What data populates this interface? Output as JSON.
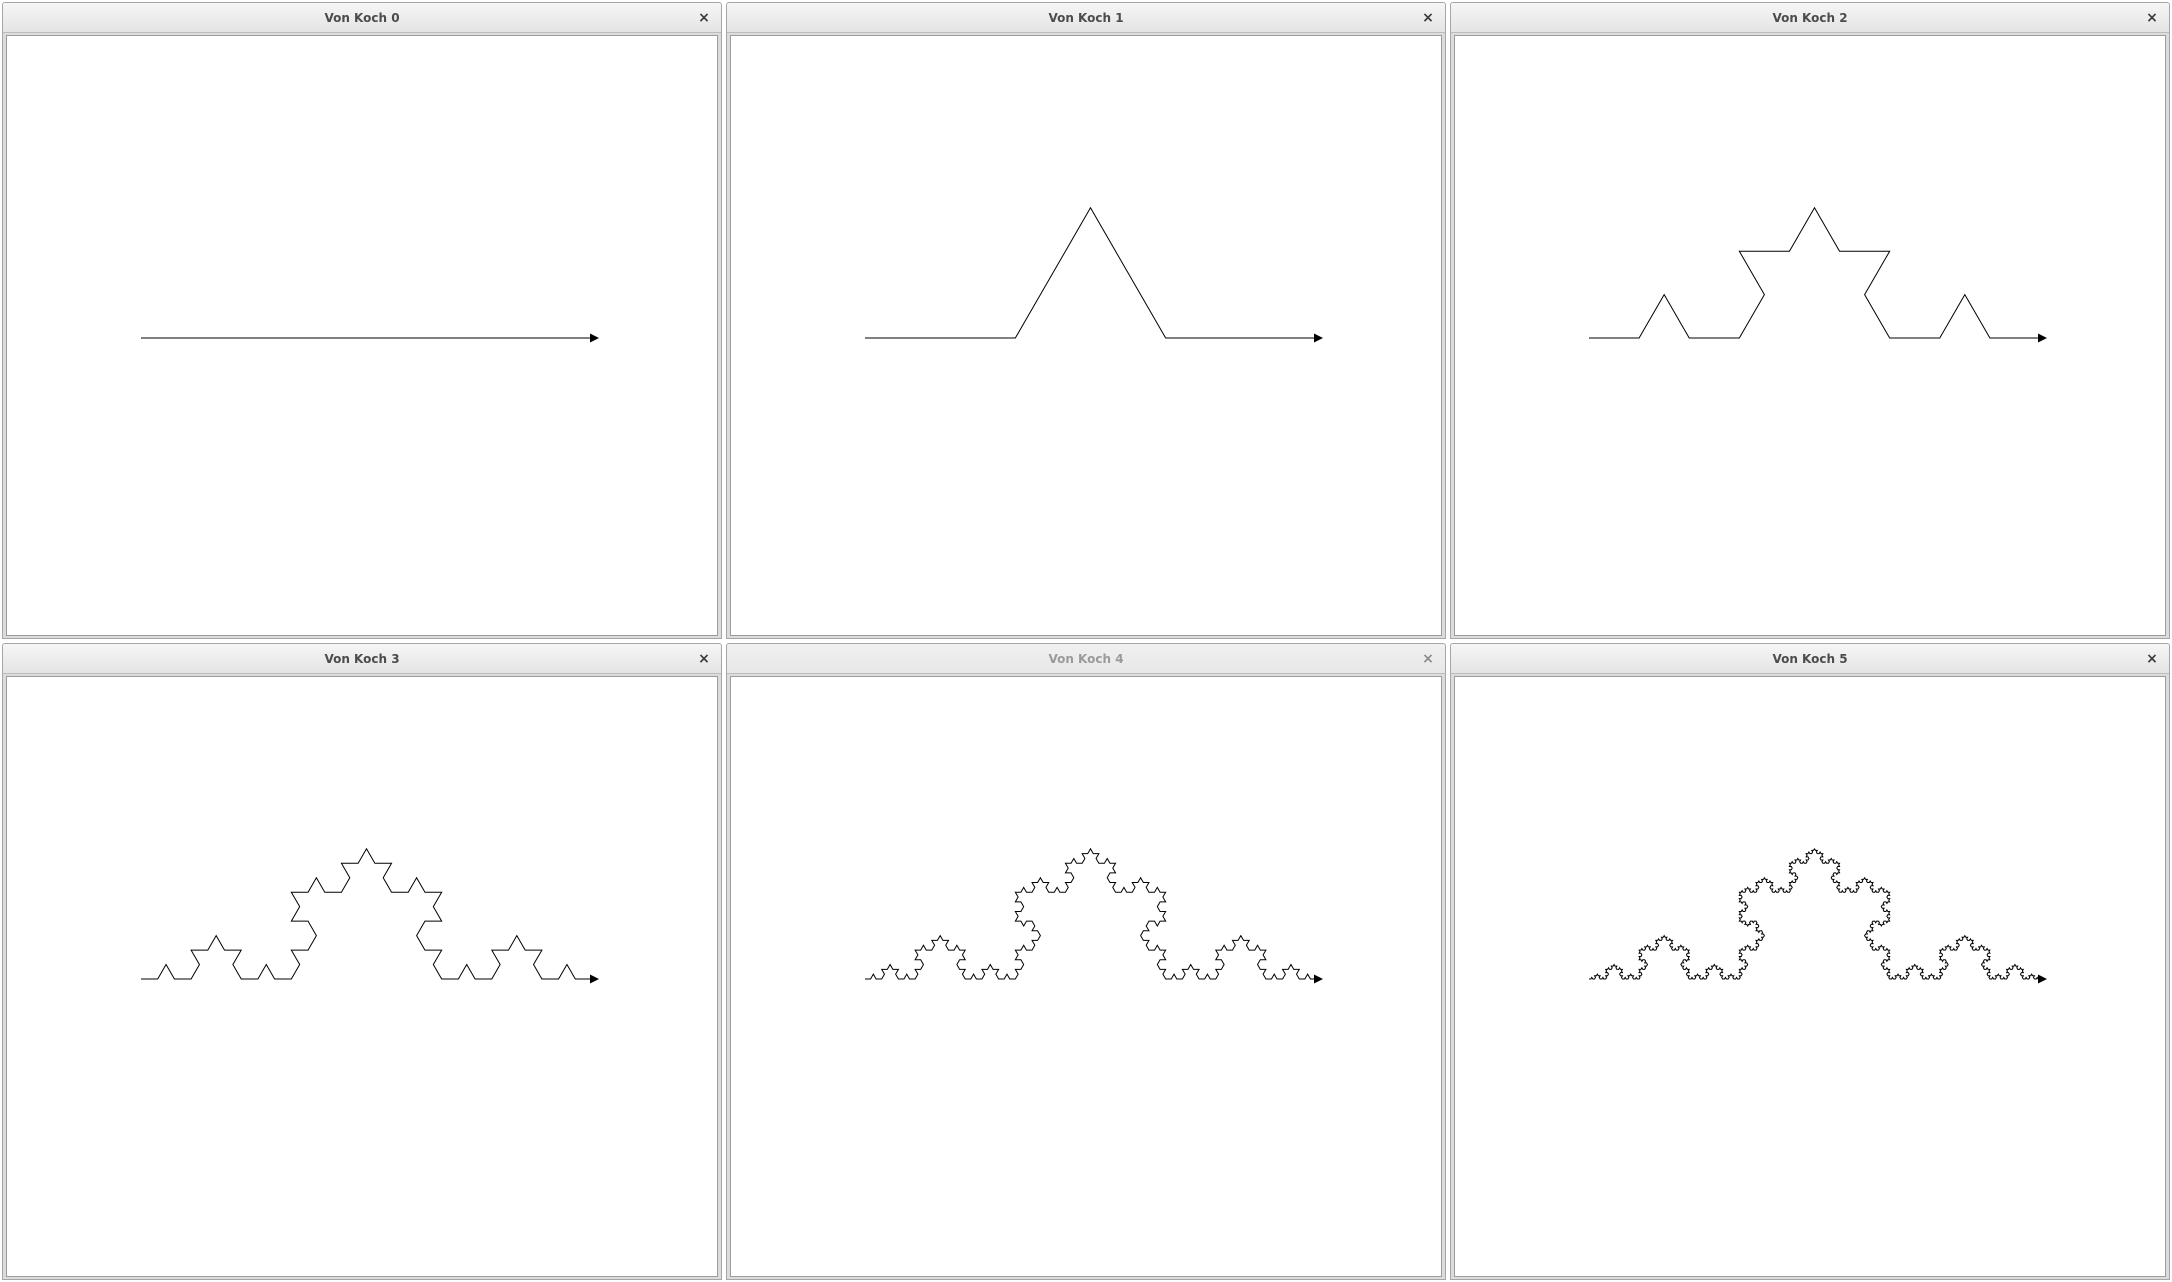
{
  "screen": {
    "windows": [
      {
        "title": "Von Koch 0",
        "close_label": "×",
        "order": 0,
        "active": true
      },
      {
        "title": "Von Koch 1",
        "close_label": "×",
        "order": 1,
        "active": true
      },
      {
        "title": "Von Koch 2",
        "close_label": "×",
        "order": 2,
        "active": true
      },
      {
        "title": "Von Koch 3",
        "close_label": "×",
        "order": 3,
        "active": true
      },
      {
        "title": "Von Koch 4",
        "close_label": "×",
        "order": 4,
        "active": false
      },
      {
        "title": "Von Koch 5",
        "close_label": "×",
        "order": 5,
        "active": true
      }
    ]
  },
  "colors": {
    "stroke": "#000000",
    "canvas_background": "#ffffff"
  },
  "icons": {
    "close": "close-icon",
    "arrow": "arrowhead-icon"
  }
}
